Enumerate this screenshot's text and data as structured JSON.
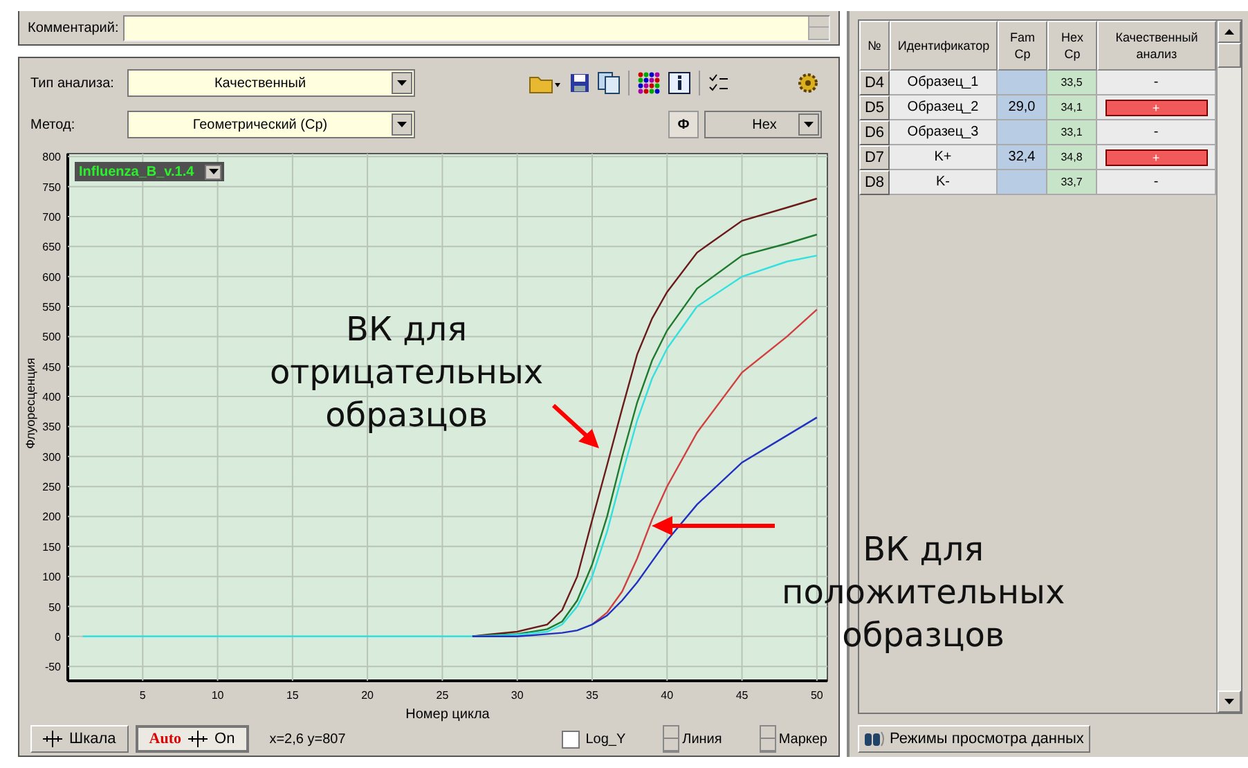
{
  "comment": {
    "label": "Комментарий:"
  },
  "analysis_type": {
    "label": "Тип анализа:",
    "value": "Качественный"
  },
  "method": {
    "label": "Метод:",
    "value": "Геометрический (Cp)"
  },
  "channel_button": "Ф",
  "channel": {
    "value": "Hex"
  },
  "chart": {
    "test_dropdown": "Influenza_B_v.1.4",
    "chart_data": {
      "type": "line",
      "grid": true,
      "xlabel": "Номер цикла",
      "ylabel": "Флуоресценция",
      "xlim": [
        0,
        50.7
      ],
      "ylim": [
        -74,
        805
      ],
      "xticks": [
        5,
        10,
        15,
        20,
        25,
        30,
        35,
        40,
        45,
        50
      ],
      "yticks": [
        -50,
        0,
        50,
        100,
        150,
        200,
        250,
        300,
        350,
        400,
        450,
        500,
        550,
        600,
        650,
        700,
        750,
        800
      ],
      "x": [
        1,
        27,
        28,
        30,
        32,
        33,
        34,
        35,
        36,
        37,
        38,
        39,
        40,
        42,
        45,
        48,
        50
      ],
      "series": [
        {
          "color": "#6b1a1a",
          "values": [
            null,
            0,
            3,
            8,
            20,
            44,
            100,
            194,
            286,
            380,
            470,
            530,
            574,
            640,
            693,
            715,
            730
          ]
        },
        {
          "color": "#1e7a2e",
          "values": [
            null,
            0,
            2,
            4,
            12,
            25,
            60,
            120,
            200,
            300,
            390,
            460,
            510,
            580,
            635,
            655,
            670
          ]
        },
        {
          "color": "#33e0e0",
          "values": [
            0,
            0,
            1,
            3,
            8,
            20,
            50,
            100,
            175,
            270,
            360,
            430,
            480,
            550,
            600,
            625,
            635
          ]
        },
        {
          "color": "#d04040",
          "values": [
            null,
            null,
            null,
            null,
            null,
            null,
            null,
            20,
            40,
            75,
            130,
            195,
            250,
            340,
            440,
            500,
            545
          ]
        },
        {
          "color": "#2030c0",
          "values": [
            null,
            0,
            0,
            0,
            4,
            6,
            10,
            20,
            35,
            60,
            90,
            125,
            160,
            220,
            290,
            335,
            365
          ]
        }
      ]
    }
  },
  "bottom_bar": {
    "scale_button": "Шкала",
    "auto_button": {
      "label": "Auto",
      "state": "On"
    },
    "coordinates": "x=2,6 y=807",
    "log_y": {
      "label": "Log_Y",
      "checked": false
    },
    "line_spinner": "Линия",
    "marker_spinner": "Маркер"
  },
  "annotations": [
    {
      "text": "ВК для\nотрицательных\nобразцов"
    },
    {
      "text": "ВК для\nположительных\nобразцов"
    }
  ],
  "table": {
    "columns": [
      "№",
      "Идентификатор",
      "Fam Cp",
      "Hex Cp",
      "Качественный анализ"
    ],
    "rows": [
      {
        "well": "D4",
        "name": "Образец_1",
        "hex": "33,5",
        "result": "-",
        "positive": false
      },
      {
        "well": "D5",
        "name": "Образец_2",
        "fam": "29,0",
        "hex": "34,1",
        "result": "+",
        "positive": true
      },
      {
        "well": "D6",
        "name": "Образец_3",
        "hex": "33,1",
        "result": "-",
        "positive": false
      },
      {
        "well": "D7",
        "name": "K+",
        "fam": "32,4",
        "hex": "34,8",
        "result": "+",
        "positive": true
      },
      {
        "well": "D8",
        "name": "K-",
        "hex": "33,7",
        "result": "-",
        "positive": false
      }
    ]
  },
  "view_modes_button": "Режимы просмотра данных"
}
